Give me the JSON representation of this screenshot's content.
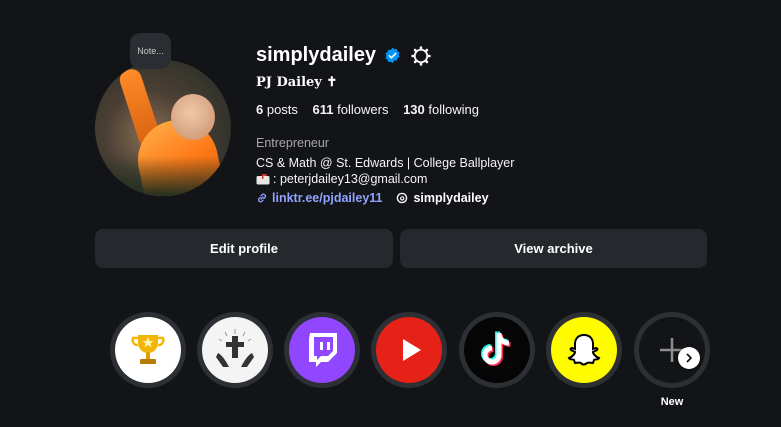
{
  "profile": {
    "username": "simplydailey",
    "display_name": "PJ Dailey ✝",
    "note_bubble": "Note...",
    "stats": {
      "posts": "6",
      "posts_label": " posts",
      "followers": "611",
      "followers_label": " followers",
      "following": "130",
      "following_label": " following"
    },
    "category": "Entrepreneur",
    "bio_line1": "CS & Math @ St. Edwards | College Ballplayer",
    "bio_line2": ": peterjdailey13@gmail.com",
    "link": "linktr.ee/pjdailey11",
    "threads_handle": "simplydailey"
  },
  "buttons": {
    "edit_profile": "Edit profile",
    "view_archive": "View archive"
  },
  "highlights": {
    "items": [
      {
        "icon": "trophy-icon"
      },
      {
        "icon": "cross-hands-icon"
      },
      {
        "icon": "twitch-icon"
      },
      {
        "icon": "youtube-icon"
      },
      {
        "icon": "tiktok-icon"
      },
      {
        "icon": "snapchat-icon"
      },
      {
        "icon": "plus-icon"
      }
    ],
    "new_label": "New"
  },
  "colors": {
    "background": "#121417",
    "button_bg": "#25282c",
    "link": "#8fa3ff",
    "verified": "#0095f6",
    "twitch": "#9146ff",
    "youtube": "#e62117",
    "snapchat": "#fffc00"
  }
}
